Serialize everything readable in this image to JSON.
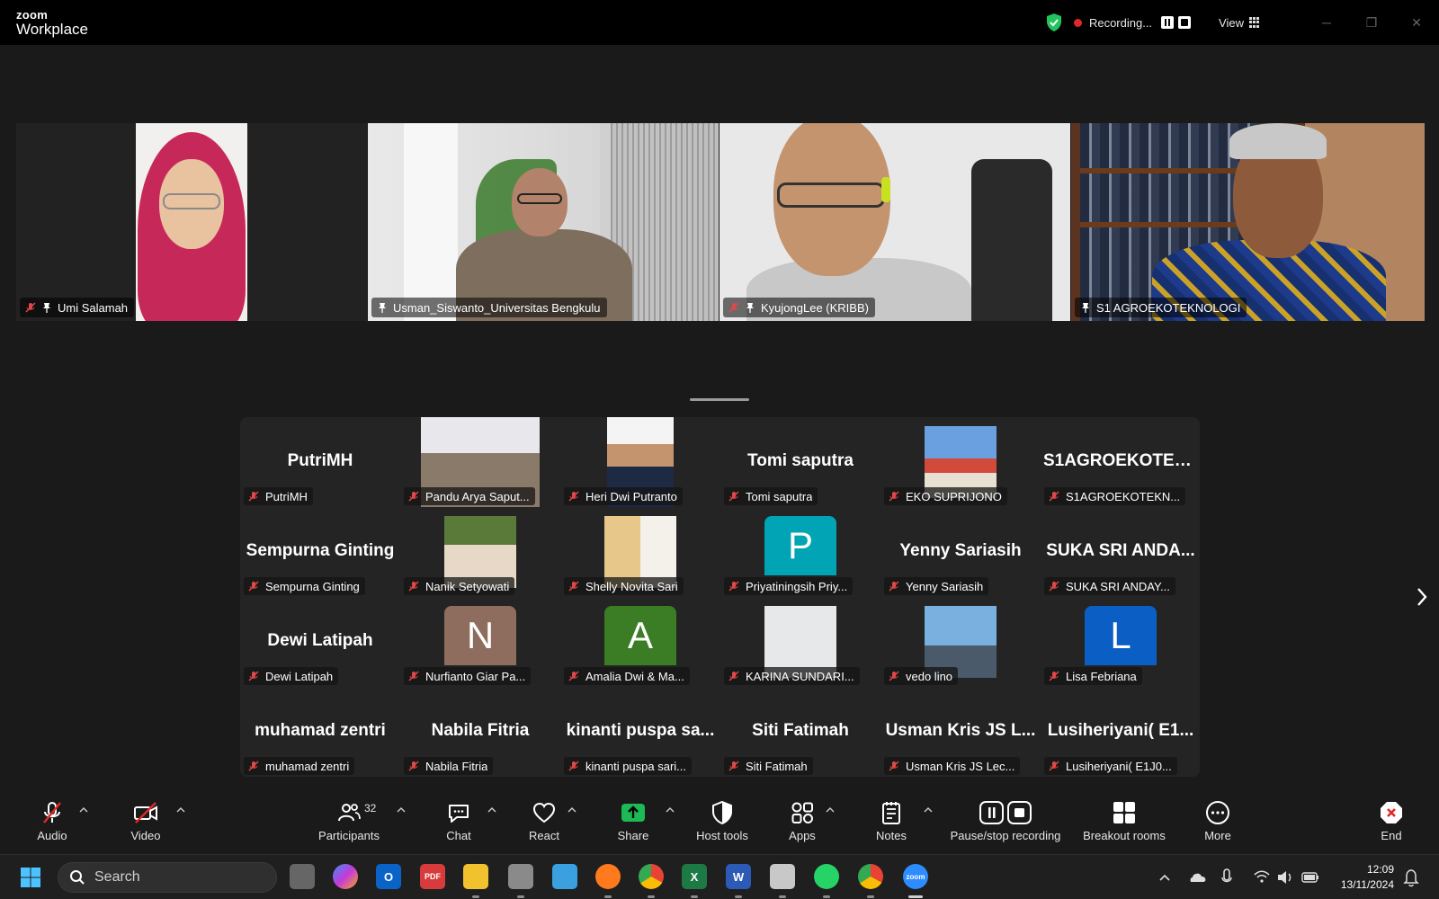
{
  "window": {
    "brand_top": "zoom",
    "brand_bottom": "Workplace",
    "recording_label": "Recording...",
    "view_label": "View"
  },
  "speakers": [
    {
      "name": "Umi Salamah",
      "muted": true
    },
    {
      "name": "Usman_Siswanto_Universitas Bengkulu",
      "muted": false
    },
    {
      "name": "KyujongLee (KRIBB)",
      "muted": true
    },
    {
      "name": "S1 AGROEKOTEKNOLOGI",
      "muted": false,
      "active": true
    }
  ],
  "gallery": [
    {
      "big": "PutriMH",
      "tag": "PutriMH"
    },
    {
      "big": "",
      "tag": "Pandu Arya Saput..."
    },
    {
      "big": "",
      "tag": "Heri Dwi Putranto"
    },
    {
      "big": "Tomi saputra",
      "tag": "Tomi saputra"
    },
    {
      "big": "",
      "tag": "EKO SUPRIJONO"
    },
    {
      "big": "S1AGROEKOTEK...",
      "tag": "S1AGROEKOTEKN..."
    },
    {
      "big": "Sempurna Ginting",
      "tag": "Sempurna Ginting"
    },
    {
      "big": "",
      "tag": "Nanik Setyowati"
    },
    {
      "big": "",
      "tag": "Shelly Novita Sari"
    },
    {
      "big": "",
      "avatar": "P",
      "tag": "Priyatiningsih Priy..."
    },
    {
      "big": "Yenny Sariasih",
      "tag": "Yenny Sariasih"
    },
    {
      "big": "SUKA SRI ANDA...",
      "tag": "SUKA SRI ANDAY..."
    },
    {
      "big": "Dewi Latipah",
      "tag": "Dewi Latipah"
    },
    {
      "big": "",
      "avatar": "N",
      "tag": "Nurfianto Giar Pa..."
    },
    {
      "big": "",
      "avatar": "A",
      "tag": "Amalia Dwi & Ma..."
    },
    {
      "big": "",
      "tag": "KARINA SUNDARI..."
    },
    {
      "big": "",
      "tag": "vedo lino"
    },
    {
      "big": "",
      "avatar": "L",
      "tag": "Lisa Febriana"
    },
    {
      "big": "muhamad zentri",
      "tag": "muhamad zentri"
    },
    {
      "big": "Nabila Fitria",
      "tag": "Nabila Fitria"
    },
    {
      "big": "kinanti puspa sa...",
      "tag": "kinanti puspa sari..."
    },
    {
      "big": "Siti Fatimah",
      "tag": "Siti Fatimah"
    },
    {
      "big": "Usman Kris JS L...",
      "tag": "Usman Kris JS Lec..."
    },
    {
      "big": "Lusiheriyani( E1...",
      "tag": "Lusiheriyani( E1J0..."
    }
  ],
  "toolbar": {
    "audio": "Audio",
    "video": "Video",
    "participants": "Participants",
    "participants_count": "32",
    "chat": "Chat",
    "react": "React",
    "share": "Share",
    "host_tools": "Host tools",
    "apps": "Apps",
    "notes": "Notes",
    "pause_recording": "Pause/stop recording",
    "breakout": "Breakout rooms",
    "more": "More",
    "end": "End"
  },
  "taskbar": {
    "search_placeholder": "Search",
    "time": "12:09",
    "date": "13/11/2024"
  },
  "colors": {
    "accent_green": "#2ed06e",
    "share_green": "#1db954",
    "end_red": "#e02828",
    "avatar_P": "#00a4b4",
    "avatar_N": "#8e6c5e",
    "avatar_A": "#3a7d24",
    "avatar_L": "#0b5fc4"
  }
}
